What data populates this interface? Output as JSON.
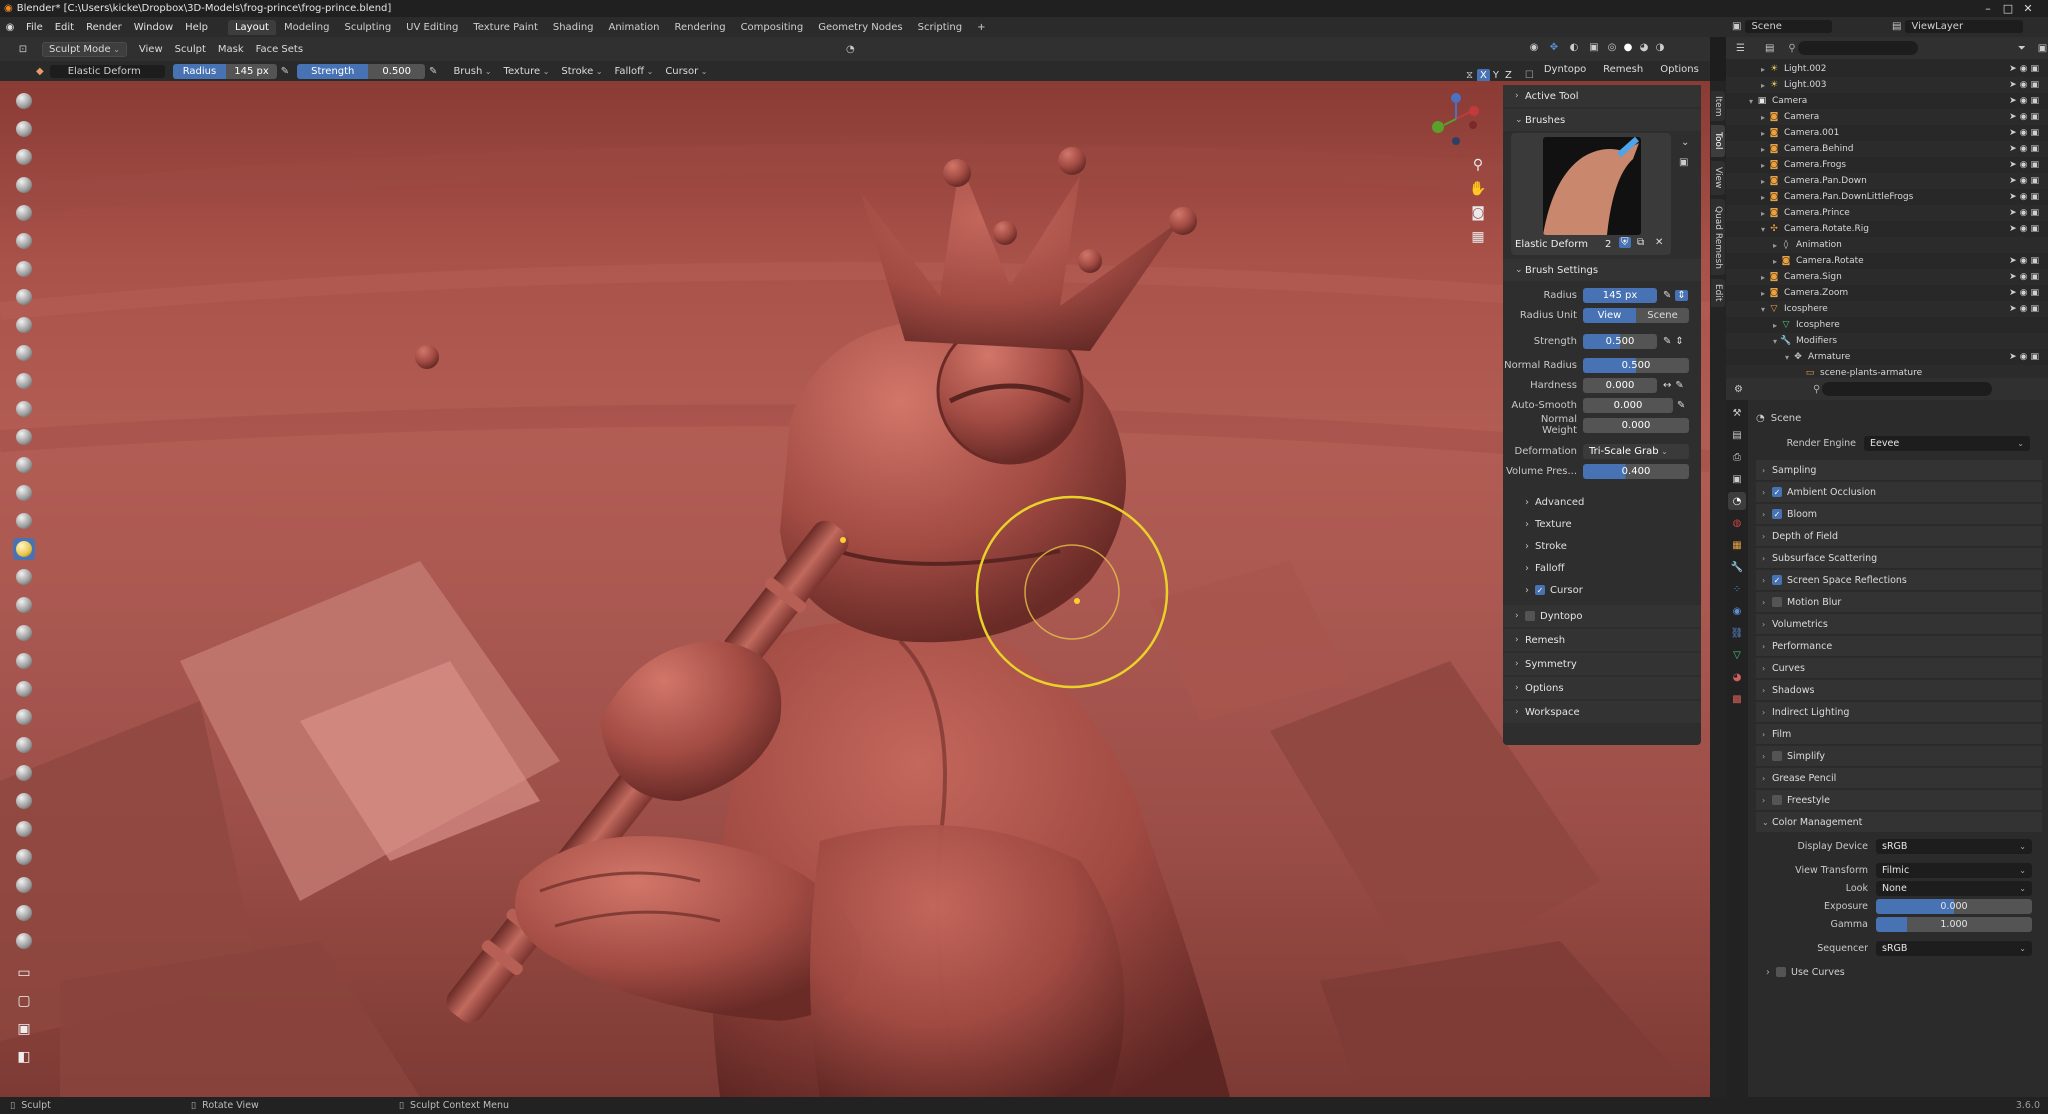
{
  "titlebar": {
    "title": "Blender* [C:\\Users\\kicke\\Dropbox\\3D-Models\\frog-prince\\frog-prince.blend]",
    "minimize": "–",
    "maximize": "□",
    "close": "✕"
  },
  "menu": {
    "items": [
      "File",
      "Edit",
      "Render",
      "Window",
      "Help"
    ]
  },
  "workspaces": {
    "tabs": [
      "Layout",
      "Modeling",
      "Sculpting",
      "UV Editing",
      "Texture Paint",
      "Shading",
      "Animation",
      "Rendering",
      "Compositing",
      "Geometry Nodes",
      "Scripting"
    ],
    "add": "+",
    "active": "Layout"
  },
  "scene_selector": {
    "scene": "Scene",
    "view_layer": "ViewLayer"
  },
  "viewport_header": {
    "mode": "Sculpt Mode",
    "menus": [
      "View",
      "Sculpt",
      "Mask",
      "Face Sets"
    ],
    "x": "X",
    "y": "Y",
    "z": "Z",
    "dyntopo": "Dyntopo",
    "remesh": "Remesh",
    "options": "Options"
  },
  "tool_header": {
    "brush_name": "Elastic Deform",
    "radius_label": "Radius",
    "radius_value": "145 px",
    "strength_label": "Strength",
    "strength_value": "0.500",
    "menus": [
      "Brush",
      "Texture",
      "Stroke",
      "Falloff",
      "Cursor"
    ]
  },
  "npanel": {
    "active_tool": "Active Tool",
    "brushes": "Brushes",
    "brush_name": "Elastic Deform",
    "brush_users": "2",
    "brush_settings": "Brush Settings",
    "radius": {
      "label": "Radius",
      "value": "145 px"
    },
    "radius_unit": {
      "label": "Radius Unit",
      "view": "View",
      "scene": "Scene"
    },
    "strength": {
      "label": "Strength",
      "value": "0.500",
      "fraction": 0.5
    },
    "normal_radius": {
      "label": "Normal Radius",
      "value": "0.500",
      "fraction": 0.5
    },
    "hardness": {
      "label": "Hardness",
      "value": "0.000"
    },
    "auto_smooth": {
      "label": "Auto-Smooth",
      "value": "0.000"
    },
    "normal_weight": {
      "label": "Normal Weight",
      "value": "0.000"
    },
    "deformation": {
      "label": "Deformation",
      "value": "Tri-Scale Grab"
    },
    "volume_preservation": {
      "label": "Volume Pres...",
      "value": "0.400",
      "fraction": 0.4
    },
    "subpanels": [
      "Advanced",
      "Texture",
      "Stroke",
      "Falloff",
      "Cursor"
    ],
    "panels": [
      "Dyntopo",
      "Remesh",
      "Symmetry",
      "Options",
      "Workspace"
    ]
  },
  "vtabs": [
    "Item",
    "Tool",
    "View",
    "Quad Remesh",
    "Edit"
  ],
  "outliner": {
    "rows": [
      {
        "name": "Light.002",
        "depth": 1,
        "icon": "light",
        "tri": "▸"
      },
      {
        "name": "Light.003",
        "depth": 1,
        "icon": "light",
        "tri": "▸"
      },
      {
        "name": "Camera",
        "depth": 0,
        "icon": "collection",
        "tri": "▾"
      },
      {
        "name": "Camera",
        "depth": 1,
        "icon": "camera",
        "tri": "▸"
      },
      {
        "name": "Camera.001",
        "depth": 1,
        "icon": "camera",
        "tri": "▸"
      },
      {
        "name": "Camera.Behind",
        "depth": 1,
        "icon": "camera",
        "tri": "▸"
      },
      {
        "name": "Camera.Frogs",
        "depth": 1,
        "icon": "camera",
        "tri": "▸"
      },
      {
        "name": "Camera.Pan.Down",
        "depth": 1,
        "icon": "camera",
        "tri": "▸"
      },
      {
        "name": "Camera.Pan.DownLittleFrogs",
        "depth": 1,
        "icon": "camera",
        "tri": "▸"
      },
      {
        "name": "Camera.Prince",
        "depth": 1,
        "icon": "camera",
        "tri": "▸"
      },
      {
        "name": "Camera.Rotate.Rig",
        "depth": 1,
        "icon": "empty",
        "tri": "▾"
      },
      {
        "name": "Animation",
        "depth": 2,
        "icon": "anim",
        "tri": "▸"
      },
      {
        "name": "Camera.Rotate",
        "depth": 2,
        "icon": "camera",
        "tri": "▸"
      },
      {
        "name": "Camera.Sign",
        "depth": 1,
        "icon": "camera",
        "tri": "▸"
      },
      {
        "name": "Camera.Zoom",
        "depth": 1,
        "icon": "camera",
        "tri": "▸"
      },
      {
        "name": "Icosphere",
        "depth": 1,
        "icon": "mesh",
        "tri": "▾"
      },
      {
        "name": "Icosphere",
        "depth": 2,
        "icon": "meshdata",
        "tri": "▸"
      },
      {
        "name": "Modifiers",
        "depth": 2,
        "icon": "modifier",
        "tri": "▾"
      },
      {
        "name": "Armature",
        "depth": 3,
        "icon": "armature",
        "tri": "▾"
      },
      {
        "name": "scene-plants-armature",
        "depth": 4,
        "icon": "bone",
        "tri": ""
      }
    ]
  },
  "properties": {
    "scene": "Scene",
    "render_engine": {
      "label": "Render Engine",
      "value": "Eevee"
    },
    "sections": [
      {
        "label": "Sampling",
        "checkbox": null
      },
      {
        "label": "Ambient Occlusion",
        "checkbox": true
      },
      {
        "label": "Bloom",
        "checkbox": true
      },
      {
        "label": "Depth of Field",
        "checkbox": null
      },
      {
        "label": "Subsurface Scattering",
        "checkbox": null
      },
      {
        "label": "Screen Space Reflections",
        "checkbox": true
      },
      {
        "label": "Motion Blur",
        "checkbox": false
      },
      {
        "label": "Volumetrics",
        "checkbox": null
      },
      {
        "label": "Performance",
        "checkbox": null
      },
      {
        "label": "Curves",
        "checkbox": null
      },
      {
        "label": "Shadows",
        "checkbox": null
      },
      {
        "label": "Indirect Lighting",
        "checkbox": null
      },
      {
        "label": "Film",
        "checkbox": null
      },
      {
        "label": "Simplify",
        "checkbox": false
      },
      {
        "label": "Grease Pencil",
        "checkbox": null
      },
      {
        "label": "Freestyle",
        "checkbox": false
      }
    ],
    "color_management": "Color Management",
    "display_device": {
      "label": "Display Device",
      "value": "sRGB"
    },
    "view_transform": {
      "label": "View Transform",
      "value": "Filmic"
    },
    "look": {
      "label": "Look",
      "value": "None"
    },
    "exposure": {
      "label": "Exposure",
      "value": "0.000"
    },
    "gamma": {
      "label": "Gamma",
      "value": "1.000"
    },
    "sequencer": {
      "label": "Sequencer",
      "value": "sRGB"
    },
    "use_curves": "Use Curves"
  },
  "statusbar": {
    "sculpt": "Sculpt",
    "rotate": "Rotate View",
    "context": "Sculpt Context Menu",
    "version": "3.6.0"
  },
  "colors": {
    "accent": "#4772b3",
    "brush_cursor": "#e8d22a",
    "clay": "#a9524a"
  }
}
